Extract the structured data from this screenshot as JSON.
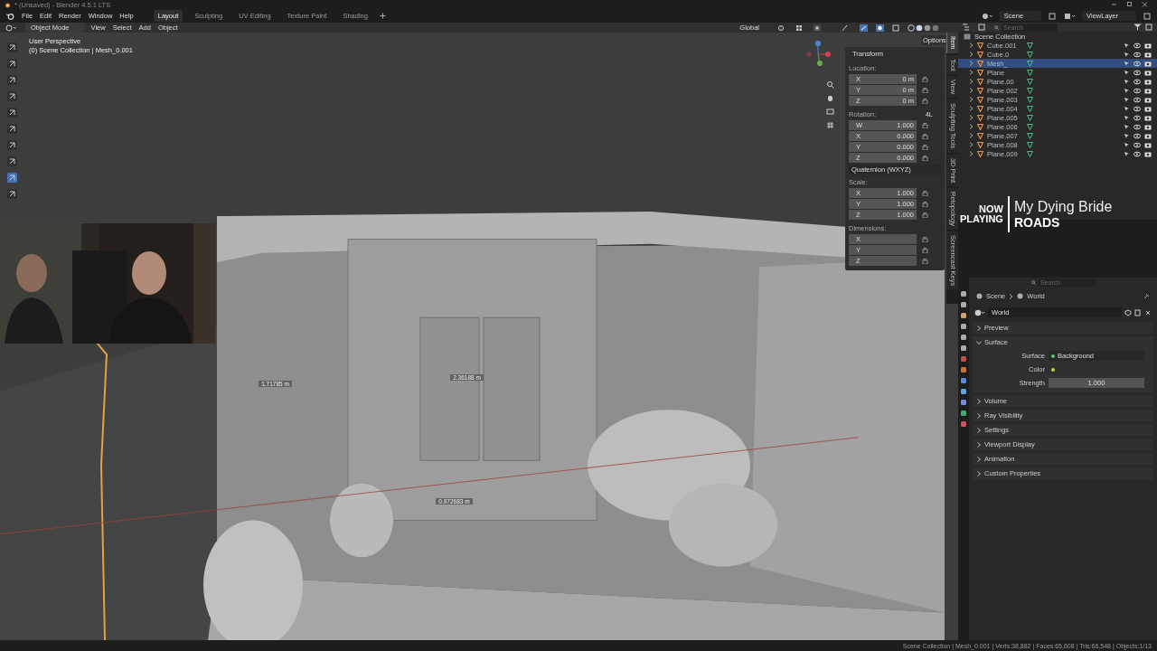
{
  "window": {
    "title": "* (Unsaved) - Blender 4.5.1 LTS"
  },
  "menus": [
    "File",
    "Edit",
    "Render",
    "Window",
    "Help"
  ],
  "workspaces": [
    {
      "label": "Layout",
      "selected": true
    },
    {
      "label": "Sculpting",
      "selected": false
    },
    {
      "label": "UV Editing",
      "selected": false
    },
    {
      "label": "Texture Paint",
      "selected": false
    },
    {
      "label": "Shading",
      "selected": false
    }
  ],
  "topbar": {
    "scene": "Scene",
    "view_layer": "ViewLayer"
  },
  "viewport": {
    "mode": "Object Mode",
    "menus": [
      "View",
      "Select",
      "Add",
      "Object"
    ],
    "orientation": "Global",
    "options": "Options",
    "info": [
      "User Perspective",
      "(0) Scene Collection | Mesh_0.001"
    ],
    "measurements": [
      "1.71785 m",
      "2.36188 m",
      "0.972683 m"
    ],
    "sidebar_tabs": [
      {
        "label": "Item",
        "selected": true
      },
      {
        "label": "Tool",
        "selected": false
      },
      {
        "label": "View",
        "selected": false
      },
      {
        "label": "Sculpting Tools",
        "selected": false
      },
      {
        "label": "3D Print",
        "selected": false
      },
      {
        "label": "Retopology",
        "selected": false
      },
      {
        "label": "Screencast Keys",
        "selected": false
      }
    ],
    "transform": {
      "title": "Transform",
      "groups": [
        {
          "label": "Location:",
          "fields": [
            {
              "axis": "X",
              "value": "0 m"
            },
            {
              "axis": "Y",
              "value": "0 m"
            },
            {
              "axis": "Z",
              "value": "0 m"
            }
          ]
        },
        {
          "label": "Rotation:",
          "mode": "4L",
          "fields": [
            {
              "axis": "W",
              "value": "1.000"
            },
            {
              "axis": "X",
              "value": "0.000"
            },
            {
              "axis": "Y",
              "value": "0.000"
            },
            {
              "axis": "Z",
              "value": "0.000"
            }
          ],
          "dropdown": "Quaternion (WXYZ)"
        },
        {
          "label": "Scale:",
          "fields": [
            {
              "axis": "X",
              "value": "1.000"
            },
            {
              "axis": "Y",
              "value": "1.000"
            },
            {
              "axis": "Z",
              "value": "1.000"
            }
          ]
        },
        {
          "label": "Dimensions:",
          "fields": [
            {
              "axis": "X"
            },
            {
              "axis": "Y"
            },
            {
              "axis": "Z"
            }
          ]
        }
      ]
    }
  },
  "now_playing": {
    "label": [
      "NOW",
      "PLAYING"
    ],
    "artist": "My Dying Bride",
    "track": "ROADS"
  },
  "outliner": {
    "search": {
      "placeholder": "Search"
    },
    "root": "Scene Collection",
    "rows": [
      {
        "name": "Cube.001",
        "selected": false
      },
      {
        "name": "Cube.0",
        "selected": false
      },
      {
        "name": "Mesh_",
        "selected": true
      },
      {
        "name": "Plane",
        "selected": false
      },
      {
        "name": "Plane.00",
        "selected": false
      },
      {
        "name": "Plane.002",
        "selected": false
      },
      {
        "name": "Plane.003",
        "selected": false
      },
      {
        "name": "Plane.004",
        "selected": false
      },
      {
        "name": "Plane.005",
        "selected": false
      },
      {
        "name": "Plane.006",
        "selected": false
      },
      {
        "name": "Plane.007",
        "selected": false
      },
      {
        "name": "Plane.008",
        "selected": false
      },
      {
        "name": "Plane.009",
        "selected": false
      }
    ]
  },
  "properties": {
    "search": {
      "placeholder": "Search"
    },
    "breadcrumb": [
      "Scene",
      "World"
    ],
    "datablock": "World",
    "panels": [
      {
        "title": "Preview",
        "expanded": false
      },
      {
        "title": "Surface",
        "expanded": true,
        "fields": [
          {
            "kind": "node",
            "label": "Surface",
            "value": "Background"
          },
          {
            "kind": "color",
            "label": "Color",
            "color": "#c8d040"
          },
          {
            "kind": "number",
            "label": "Strength",
            "value": "1.000"
          }
        ]
      },
      {
        "title": "Volume",
        "expanded": false
      },
      {
        "title": "Ray Visibility",
        "expanded": false
      },
      {
        "title": "Settings",
        "expanded": false
      },
      {
        "title": "Viewport Display",
        "expanded": false
      },
      {
        "title": "Animation",
        "expanded": false
      },
      {
        "title": "Custom Properties",
        "expanded": false
      }
    ]
  },
  "status_bar": "Scene Collection | Mesh_0.001 | Verts:38,882 | Faces:65,608 | Tris:66,548 | Objects:1/13"
}
